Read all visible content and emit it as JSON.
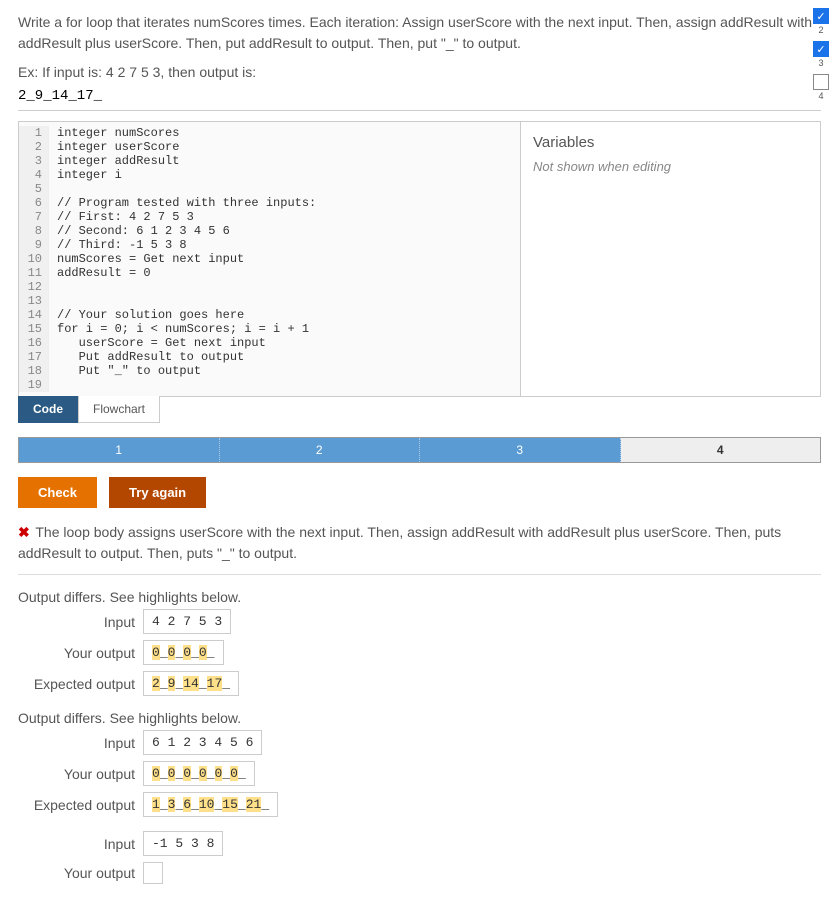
{
  "problem": {
    "description": "Write a for loop that iterates numScores times. Each iteration: Assign userScore with the next input. Then, assign addResult with addResult plus userScore. Then, put addResult to output. Then, put \"_\" to output.",
    "example_label": "Ex: If input is: 4 2 7 5 3, then output is:",
    "example_output": "2_9_14_17_"
  },
  "checkboxes": [
    {
      "checked": true,
      "num": "2"
    },
    {
      "checked": true,
      "num": "3"
    },
    {
      "checked": false,
      "num": "4"
    }
  ],
  "code_lines": [
    "integer numScores",
    "integer userScore",
    "integer addResult",
    "integer i",
    "",
    "// Program tested with three inputs:",
    "// First: 4 2 7 5 3",
    "// Second: 6 1 2 3 4 5 6",
    "// Third: -1 5 3 8",
    "numScores = Get next input",
    "addResult = 0",
    "",
    "",
    "// Your solution goes here",
    "for i = 0; i < numScores; i = i + 1",
    "   userScore = Get next input",
    "   Put addResult to output",
    "   Put \"_\" to output",
    ""
  ],
  "vars": {
    "title": "Variables",
    "note": "Not shown when editing"
  },
  "tabs": {
    "code": "Code",
    "flowchart": "Flowchart"
  },
  "progress": [
    "1",
    "2",
    "3",
    "4"
  ],
  "buttons": {
    "check": "Check",
    "try": "Try again"
  },
  "feedback": {
    "msg": "The loop body assigns userScore with the next input. Then, assign addResult with addResult plus userScore. Then, puts addResult to output. Then, puts \"_\" to output."
  },
  "labels": {
    "differs": "Output differs. See highlights below.",
    "input": "Input",
    "your": "Your output",
    "expected": "Expected output"
  },
  "cases": [
    {
      "differs": true,
      "input": "4 2 7 5 3",
      "your_tokens": [
        [
          "0",
          true
        ],
        [
          "_",
          false
        ],
        [
          "0",
          true
        ],
        [
          "_",
          false
        ],
        [
          "0",
          true
        ],
        [
          "_",
          false
        ],
        [
          "0",
          true
        ],
        [
          "_",
          false
        ]
      ],
      "expected_tokens": [
        [
          "2",
          true
        ],
        [
          "_",
          false
        ],
        [
          "9",
          true
        ],
        [
          "_",
          false
        ],
        [
          "14",
          true
        ],
        [
          "_",
          false
        ],
        [
          "17",
          true
        ],
        [
          "_",
          false
        ]
      ]
    },
    {
      "differs": true,
      "input": "6 1 2 3 4 5 6",
      "your_tokens": [
        [
          "0",
          true
        ],
        [
          "_",
          false
        ],
        [
          "0",
          true
        ],
        [
          "_",
          false
        ],
        [
          "0",
          true
        ],
        [
          "_",
          false
        ],
        [
          "0",
          true
        ],
        [
          "_",
          false
        ],
        [
          "0",
          true
        ],
        [
          "_",
          false
        ],
        [
          "0",
          true
        ],
        [
          "_",
          false
        ]
      ],
      "expected_tokens": [
        [
          "1",
          true
        ],
        [
          "_",
          false
        ],
        [
          "3",
          true
        ],
        [
          "_",
          false
        ],
        [
          "6",
          true
        ],
        [
          "_",
          false
        ],
        [
          "10",
          true
        ],
        [
          "_",
          false
        ],
        [
          "15",
          true
        ],
        [
          "_",
          false
        ],
        [
          "21",
          true
        ],
        [
          "_",
          false
        ]
      ]
    },
    {
      "differs": false,
      "input": "-1 5 3 8",
      "your_tokens": [],
      "expected_tokens": null
    }
  ]
}
